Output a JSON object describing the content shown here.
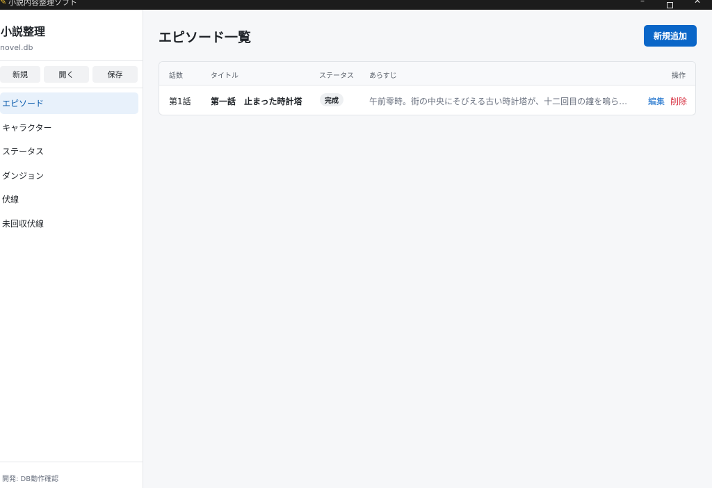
{
  "window": {
    "title": "小説内容整理ソフト",
    "controls": {
      "minimize": "–",
      "close": "✕"
    }
  },
  "sidebar": {
    "app_name": "小説整理",
    "db_file": "novel.db",
    "file_buttons": {
      "new": "新規",
      "open": "開く",
      "save": "保存"
    },
    "nav": [
      {
        "label": "エピソード",
        "active": true
      },
      {
        "label": "キャラクター",
        "active": false
      },
      {
        "label": "ステータス",
        "active": false
      },
      {
        "label": "ダンジョン",
        "active": false
      },
      {
        "label": "伏線",
        "active": false
      },
      {
        "label": "未回収伏線",
        "active": false
      }
    ],
    "footer": "開発: DB動作確認"
  },
  "main": {
    "title": "エピソード一覧",
    "add_button": "新規追加",
    "table": {
      "headers": {
        "episode": "話数",
        "title": "タイトル",
        "status": "ステータス",
        "synopsis": "あらすじ",
        "actions": "操作"
      },
      "rows": [
        {
          "episode": "第1話",
          "title": "第一話　止まった時計塔",
          "status": "完成",
          "synopsis": "午前零時。街の中央にそびえる古い時計塔が、十二回目の鐘を鳴らした。…",
          "edit": "編集",
          "delete": "削除"
        }
      ]
    }
  },
  "colors": {
    "accent": "#0a66c8",
    "danger": "#d83545",
    "active_nav_bg": "#e8f1fb"
  }
}
